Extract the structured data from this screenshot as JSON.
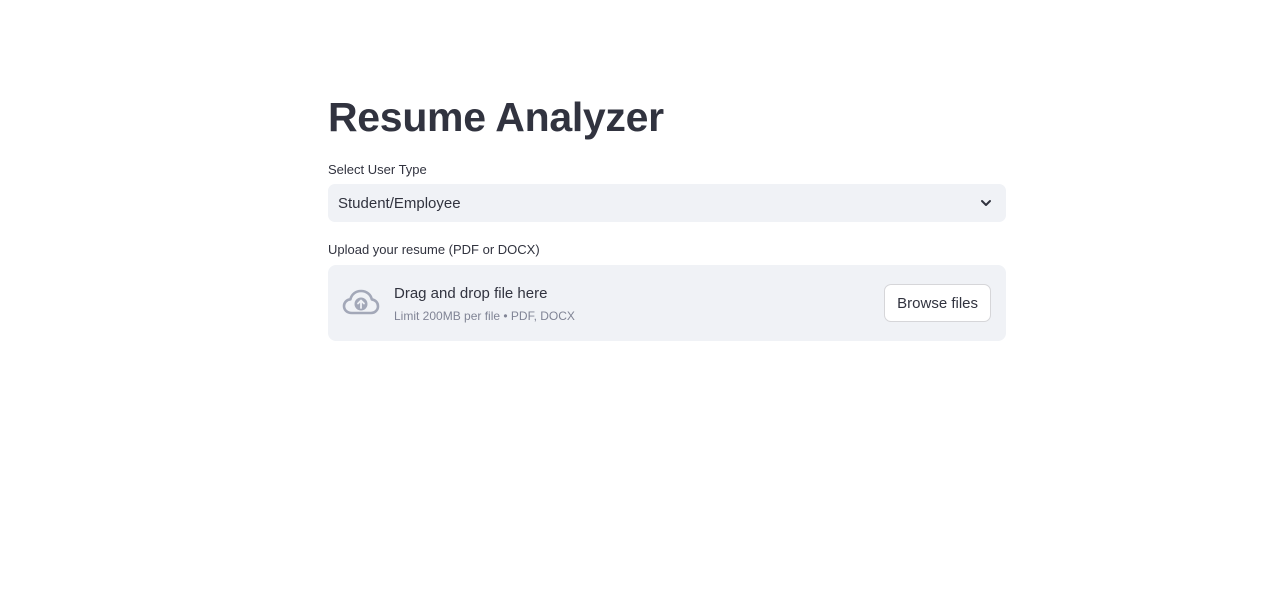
{
  "app": {
    "title": "Resume Analyzer"
  },
  "user_type": {
    "label": "Select User Type",
    "selected": "Student/Employee",
    "icon": "chevron-down-icon"
  },
  "upload": {
    "label": "Upload your resume (PDF or DOCX)",
    "dropzone_text": "Drag and drop file here",
    "limit_text": "Limit 200MB per file • PDF, DOCX",
    "browse_label": "Browse files",
    "icon": "cloud-upload-icon"
  },
  "colors": {
    "text": "#31333f",
    "muted_text": "#808495",
    "field_background": "#f0f2f6",
    "icon": "#a3a8b8",
    "button_border": "#d6d6d9"
  }
}
